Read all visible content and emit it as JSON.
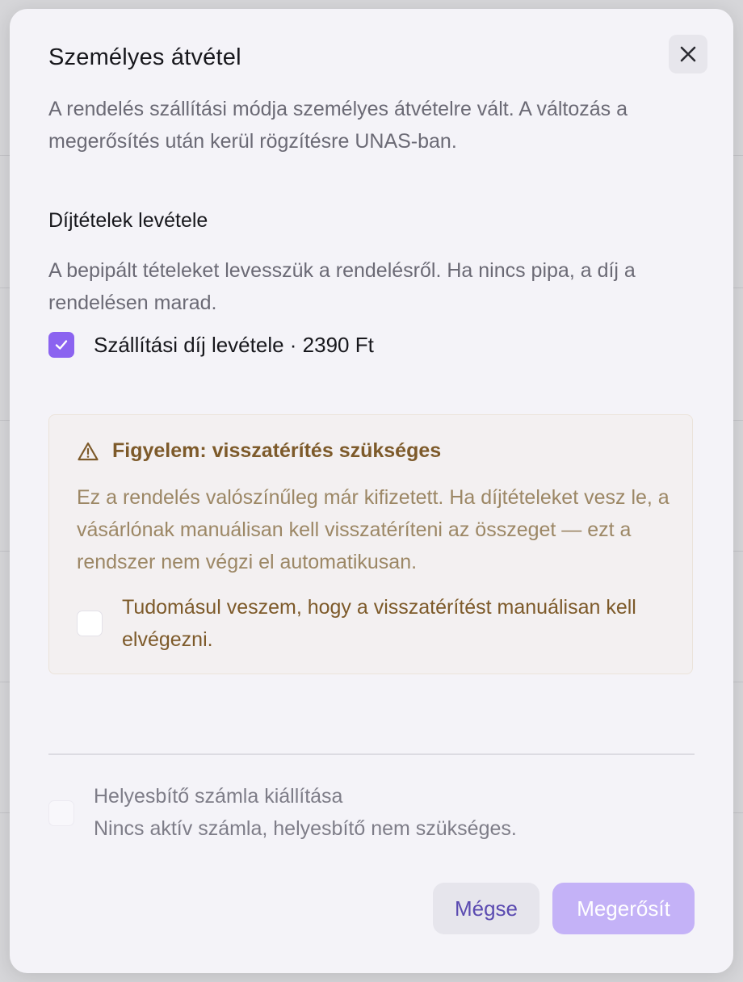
{
  "dialog": {
    "title": "Személyes átvétel",
    "description": "A rendelés szállítási módja személyes átvételre vált. A változás a megerősítés után kerül rögzítésre UNAS-ban.",
    "close_icon": "close-icon"
  },
  "fees": {
    "section_title": "Díjtételek levétele",
    "section_description": "A bepipált tételeket levesszük a rendelésről. Ha nincs pipa, a díj a rendelésen marad.",
    "shipping_fee_label": "Szállítási díj levétele · 2390 Ft",
    "shipping_fee_checked": true
  },
  "warning": {
    "icon": "warning-triangle-icon",
    "title": "Figyelem: visszatérítés szükséges",
    "text": "Ez a rendelés valószínűleg már kifizetett. Ha díjtételeket vesz le, a vásárlónak manuálisan kell visszatéríteni az összeget — ezt a rendszer nem végzi el automatikusan.",
    "ack_label": "Tudomásul veszem, hogy a visszatérítést manuálisan kell elvégezni.",
    "ack_checked": false
  },
  "invoice": {
    "label": "Helyesbítő számla kiállítása",
    "sublabel": "Nincs aktív számla, helyesbítő nem szükséges.",
    "checked": false,
    "disabled": true
  },
  "footer": {
    "cancel_label": "Mégse",
    "confirm_label": "Megerősít"
  },
  "colors": {
    "accent": "#8b63f0",
    "accent_disabled": "#c4b2f7",
    "warning_text": "#7d5a2a"
  }
}
